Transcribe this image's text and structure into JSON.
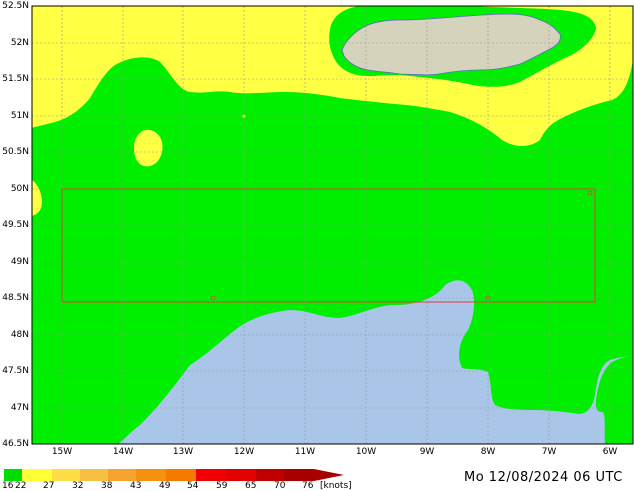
{
  "map": {
    "lat_labels": [
      "52.5N",
      "52N",
      "51.5N",
      "51N",
      "50.5N",
      "50N",
      "49.5N",
      "49N",
      "48.5N",
      "48N",
      "47.5N",
      "47N",
      "46.5N"
    ],
    "lon_labels": [
      "15W",
      "14W",
      "13W",
      "12W",
      "11W",
      "10W",
      "9W",
      "8W",
      "7W",
      "6W"
    ],
    "colors": {
      "water_bg": "#a9c5e8",
      "green": "#00ee00",
      "yellow": "#ffff44",
      "land": "#d6d3bd",
      "box": "#e0413a",
      "grid": "#9a9a9a"
    }
  },
  "legend": {
    "bins": [
      {
        "color": "#00dd00"
      },
      {
        "color": "#ffff33"
      },
      {
        "color": "#ffdd44"
      },
      {
        "color": "#f7c040"
      },
      {
        "color": "#f5a52e"
      },
      {
        "color": "#f59010"
      },
      {
        "color": "#f57a00"
      },
      {
        "color": "#f00000"
      },
      {
        "color": "#e00000"
      },
      {
        "color": "#c00000"
      },
      {
        "color": "#a80000"
      }
    ],
    "labels": [
      "16",
      "22",
      "27",
      "32",
      "38",
      "43",
      "49",
      "54",
      "59",
      "65",
      "70",
      "76"
    ],
    "unit": "[knots]"
  },
  "timestamp": "Mo 12/08/2024 06 UTC"
}
